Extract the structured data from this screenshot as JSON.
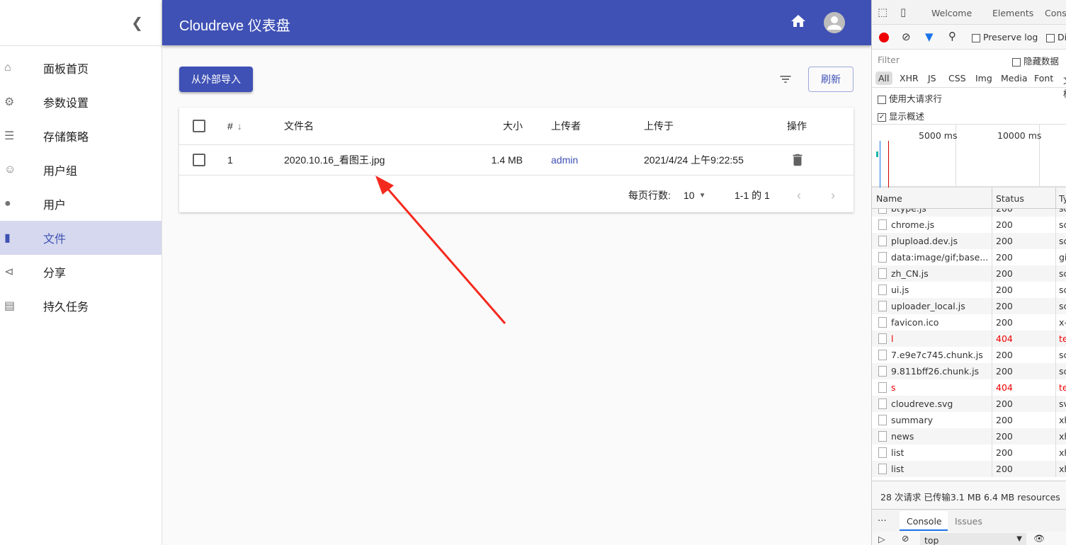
{
  "sidebar": {
    "items": [
      {
        "label": "面板首页",
        "icon": "home-icon"
      },
      {
        "label": "参数设置",
        "icon": "gear-icon"
      },
      {
        "label": "存储策略",
        "icon": "storage-icon"
      },
      {
        "label": "用户组",
        "icon": "group-icon"
      },
      {
        "label": "用户",
        "icon": "person-icon"
      },
      {
        "label": "文件",
        "icon": "file-icon",
        "selected": true
      },
      {
        "label": "分享",
        "icon": "share-icon"
      },
      {
        "label": "持久任务",
        "icon": "assignment-icon"
      }
    ]
  },
  "header": {
    "title": "Cloudreve 仪表盘"
  },
  "toolbar": {
    "import_label": "从外部导入",
    "refresh_label": "刷新"
  },
  "table": {
    "headers": [
      "#",
      "文件名",
      "大小",
      "上传者",
      "上传于",
      "操作"
    ],
    "rows": [
      {
        "id": "1",
        "name": "2020.10.16_看图王.jpg",
        "size": "1.4 MB",
        "uploader": "admin",
        "uploaded": "2021/4/24 上午9:22:55"
      }
    ]
  },
  "pagination": {
    "rows_per_page_label": "每页行数:",
    "rows_per_page": "10",
    "range": "1-1 的 1"
  },
  "devtools": {
    "tabs": [
      "Welcome",
      "Elements",
      "Console"
    ],
    "preserve_log": "Preserve log",
    "disable_cache": "Disable cache",
    "filter_placeholder": "Filter",
    "hide_data": "隐藏数据",
    "types": [
      "All",
      "XHR",
      "JS",
      "CSS",
      "Img",
      "Media",
      "Font",
      "文档"
    ],
    "big_rows": "使用大请求行",
    "overview": "显示概述",
    "timeline": [
      "5000 ms",
      "10000 ms"
    ],
    "columns": [
      "Name",
      "Status",
      "Type"
    ],
    "requests": [
      {
        "name": "btype.js",
        "status": "200",
        "type": "script"
      },
      {
        "name": "chrome.js",
        "status": "200",
        "type": "script"
      },
      {
        "name": "plupload.dev.js",
        "status": "200",
        "type": "script"
      },
      {
        "name": "data:image/gif;base...",
        "status": "200",
        "type": "gif"
      },
      {
        "name": "zh_CN.js",
        "status": "200",
        "type": "script"
      },
      {
        "name": "ui.js",
        "status": "200",
        "type": "script"
      },
      {
        "name": "uploader_local.js",
        "status": "200",
        "type": "script"
      },
      {
        "name": "favicon.ico",
        "status": "200",
        "type": "x-icon"
      },
      {
        "name": "l",
        "status": "404",
        "type": "text"
      },
      {
        "name": "7.e9e7c745.chunk.js",
        "status": "200",
        "type": "script"
      },
      {
        "name": "9.811bff26.chunk.js",
        "status": "200",
        "type": "script"
      },
      {
        "name": "s",
        "status": "404",
        "type": "text"
      },
      {
        "name": "cloudreve.svg",
        "status": "200",
        "type": "svg+xml"
      },
      {
        "name": "summary",
        "status": "200",
        "type": "xhr"
      },
      {
        "name": "news",
        "status": "200",
        "type": "xhr"
      },
      {
        "name": "list",
        "status": "200",
        "type": "xhr"
      },
      {
        "name": "list",
        "status": "200",
        "type": "xhr"
      }
    ],
    "summary": "28 次请求  已传输3.1 MB  6.4 MB resources",
    "drawer_tabs": [
      "Console",
      "Issues"
    ],
    "context": "top"
  },
  "colors": {
    "primary": "#3f51b5",
    "error": "#e00000",
    "arrow": "#f42a1e"
  }
}
